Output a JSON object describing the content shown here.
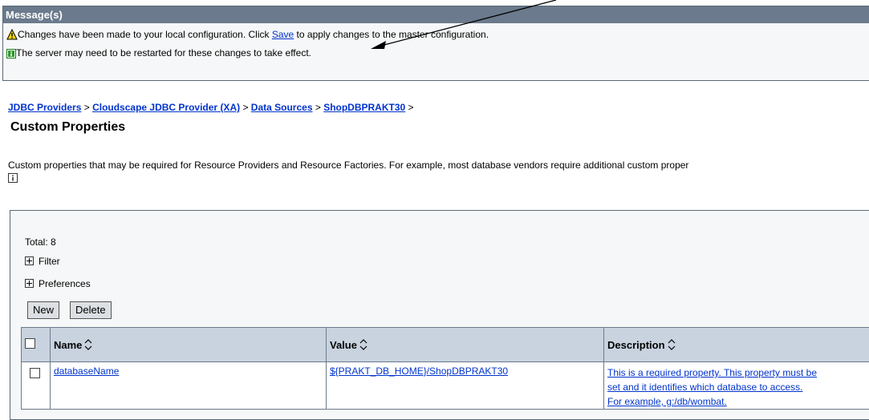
{
  "messages": {
    "header": "Message(s)",
    "line1_before": "Changes have been made to your local configuration. Click ",
    "line1_link": "Save",
    "line1_after": " to apply changes to the master configuration.",
    "line2": "The server may need to be restarted for these changes to take effect."
  },
  "breadcrumb": [
    {
      "label": "JDBC Providers"
    },
    {
      "label": "Cloudscape JDBC Provider (XA)"
    },
    {
      "label": "Data Sources"
    },
    {
      "label": "ShopDBPRAKT30"
    }
  ],
  "breadcrumb_sep": " > ",
  "page": {
    "title": "Custom Properties",
    "description": "Custom properties that may be required for Resource Providers and Resource Factories. For example, most database vendors require additional custom proper"
  },
  "panel": {
    "total": "Total: 8",
    "filter": "Filter",
    "preferences": "Preferences",
    "new_label": "New",
    "delete_label": "Delete"
  },
  "table": {
    "columns": [
      "Name",
      "Value",
      "Description"
    ],
    "rows": [
      {
        "name": "databaseName",
        "value": "${PRAKT_DB_HOME}/ShopDBPRAKT30",
        "description": [
          "This is a required property. This property must be",
          "set and it identifies which database to access.",
          "For example, g:/db/wombat."
        ]
      }
    ]
  },
  "colors": {
    "header_bg": "#6b7a8c",
    "link": "#0033cc",
    "table_header": "#c8d3df"
  }
}
